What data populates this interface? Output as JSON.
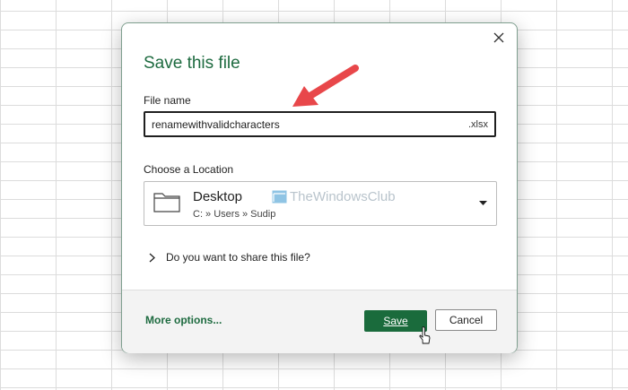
{
  "dialog": {
    "title": "Save this file",
    "close_icon": "close-icon",
    "filename": {
      "label": "File name",
      "value": "renamewithvalidcharacters",
      "extension": ".xlsx"
    },
    "location": {
      "label": "Choose a Location",
      "name": "Desktop",
      "path": "C: » Users » Sudip",
      "icon": "folder-icon",
      "dropdown_icon": "caret-down-icon"
    },
    "share": {
      "label": "Do you want to share this file?",
      "icon": "chevron-right-icon"
    },
    "footer": {
      "more_options": "More options...",
      "save_label": "Save",
      "cancel_label": "Cancel"
    }
  },
  "watermark": {
    "text": "TheWindowsClub"
  },
  "colors": {
    "accent": "#1e6b40",
    "save_button": "#1a6b3c",
    "annotation_arrow": "#e8474a"
  }
}
